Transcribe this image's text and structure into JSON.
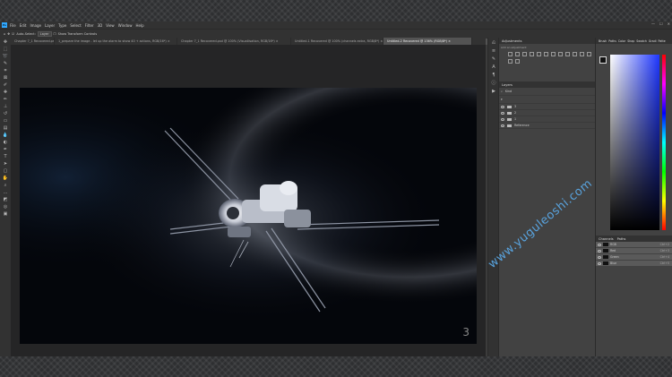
{
  "app": {
    "logo": "Ps"
  },
  "menu": [
    "File",
    "Edit",
    "Image",
    "Layer",
    "Type",
    "Select",
    "Filter",
    "3D",
    "View",
    "Window",
    "Help"
  ],
  "window_controls": [
    "—",
    "☐",
    "✕"
  ],
  "options": {
    "auto_select": "Auto-Select:",
    "layer_select": "Layer",
    "transform": "Show Transform Controls"
  },
  "tabs": [
    {
      "label": "Chapter 7_1 Recovered.psd @ 100% (...",
      "active": false
    },
    {
      "label": "1_prepare the image - let up the alarm to show 40 + actions, RGB/16*) ×",
      "active": false
    },
    {
      "label": "Chapter 7_1 Recovered.psd @ 100% (Visualiisation, RGB/16*) ×",
      "active": false
    },
    {
      "label": "Untitled-1 Recovered @ 100% (channels extra, RGB/8*) ×",
      "active": false
    },
    {
      "label": "Untitled-2 Recovered @ 136% (RGB/8*) ×",
      "active": true
    }
  ],
  "document": {
    "number": "3"
  },
  "adjustments": {
    "title": "Adjustments",
    "subtitle": "Add an adjustment"
  },
  "layers": {
    "title": "Layers",
    "kind": "Kind",
    "rows": [
      {
        "name": "3"
      },
      {
        "name": "2"
      },
      {
        "name": "1"
      },
      {
        "name": "Reference"
      }
    ]
  },
  "right_tabs": [
    "Brush",
    "Paths",
    "Color",
    "Shap",
    "Swatch",
    "Gradi",
    "Patte"
  ],
  "channels": {
    "tabs": [
      "Channels",
      "Paths"
    ],
    "rows": [
      {
        "name": "RGB",
        "key": "Ctrl+2"
      },
      {
        "name": "Red",
        "key": "Ctrl+3"
      },
      {
        "name": "Green",
        "key": "Ctrl+4"
      },
      {
        "name": "Blue",
        "key": "Ctrl+5"
      }
    ]
  },
  "watermark": "www.yuguleoshi.com",
  "colors": {
    "ps_blue": "#31a8ff",
    "watermark": "#5aa8e6",
    "ui_dark": "#323232",
    "ui_mid": "#535353"
  }
}
